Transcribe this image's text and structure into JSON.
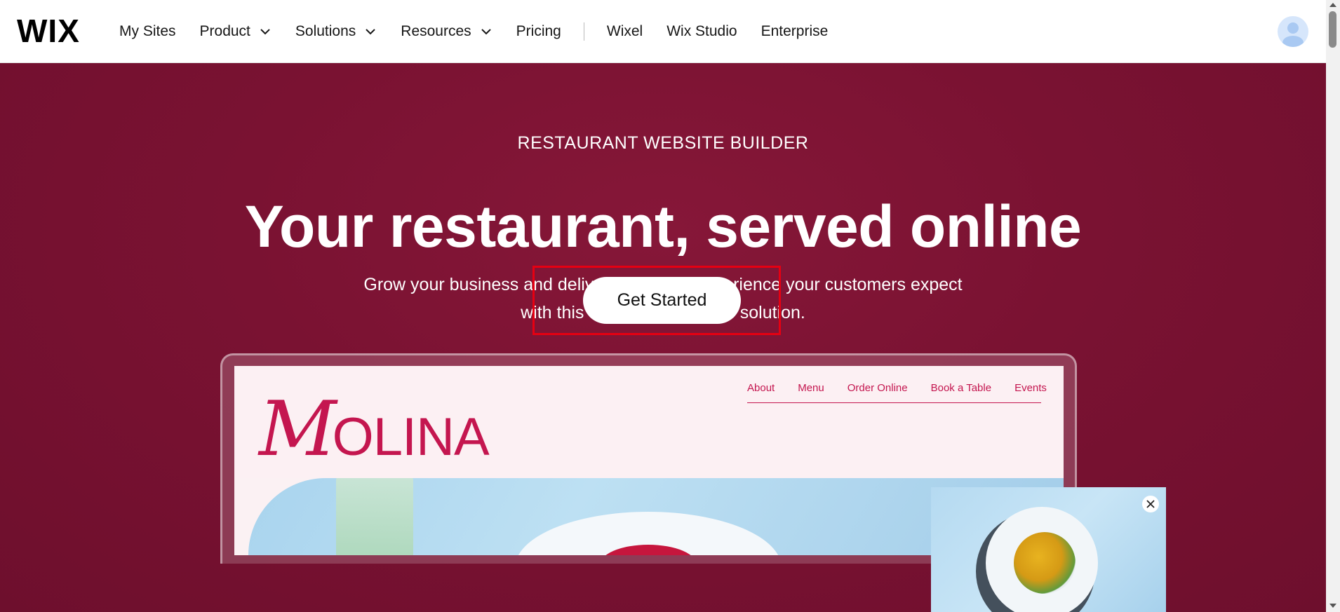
{
  "nav": {
    "logo": "WIX",
    "items": [
      {
        "label": "My Sites",
        "dropdown": false
      },
      {
        "label": "Product",
        "dropdown": true
      },
      {
        "label": "Solutions",
        "dropdown": true
      },
      {
        "label": "Resources",
        "dropdown": true
      },
      {
        "label": "Pricing",
        "dropdown": false
      }
    ],
    "secondary_items": [
      {
        "label": "Wixel"
      },
      {
        "label": "Wix Studio"
      },
      {
        "label": "Enterprise"
      }
    ],
    "avatar_icon": "user-avatar-icon"
  },
  "hero": {
    "eyebrow": "RESTAURANT WEBSITE BUILDER",
    "headline": "Your restaurant, served online",
    "subtitle_line1": "Grow your business and deliver the online experience your customers expect",
    "subtitle_line2": "with this all-in-one business solution.",
    "cta_label": "Get Started",
    "background_color": "#7a1232",
    "highlight_color": "#e60012"
  },
  "mockup": {
    "brand": "MOLINA",
    "brand_first_letter": "M",
    "brand_rest": "OLINA",
    "brand_color": "#c4164f",
    "nav": [
      "About",
      "Menu",
      "Order Online",
      "Book a Table",
      "Events"
    ]
  },
  "popup": {
    "close_icon": "close-icon"
  }
}
